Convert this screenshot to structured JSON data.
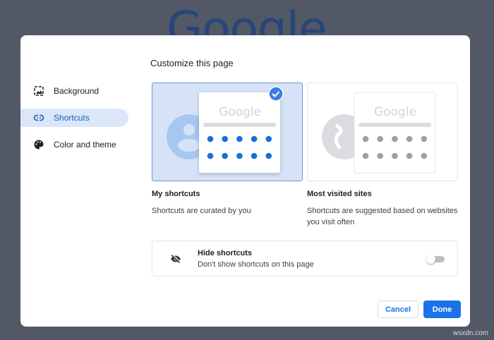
{
  "background_logo": "Google",
  "dialog": {
    "title": "Customize this page",
    "sidebar": [
      {
        "label": "Background",
        "icon": "image-icon"
      },
      {
        "label": "Shortcuts",
        "icon": "link-icon",
        "active": true
      },
      {
        "label": "Color and theme",
        "icon": "palette-icon"
      }
    ],
    "options": [
      {
        "name": "My shortcuts",
        "desc": "Shortcuts are curated by you",
        "preview_logo": "Google",
        "selected": true
      },
      {
        "name": "Most visited sites",
        "desc": "Shortcuts are suggested based on websites you visit often",
        "preview_logo": "Google",
        "selected": false
      }
    ],
    "hide": {
      "title": "Hide shortcuts",
      "desc": "Don't show shortcuts on this page",
      "enabled": false
    },
    "cancel": "Cancel",
    "done": "Done"
  },
  "colors": {
    "accent": "#1a73e8",
    "selected_bg": "#d6e3f7"
  },
  "watermark": "wsxdn.com"
}
